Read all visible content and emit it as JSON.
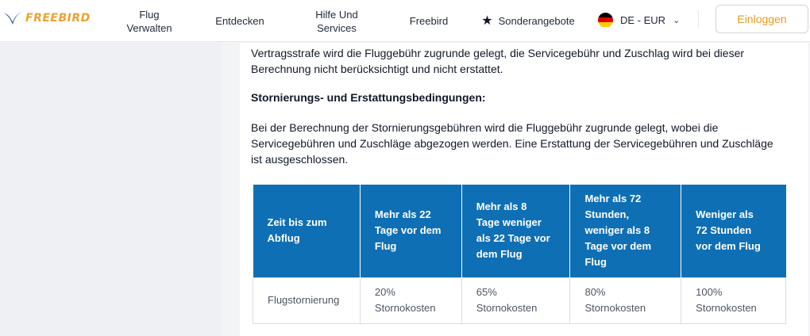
{
  "brand": {
    "name": "FREEBIRD",
    "logo_color": "#f0a030",
    "bird_color": "#1d4f9a"
  },
  "nav": {
    "flug": "Flug\nVerwalten",
    "entdecken": "Entdecken",
    "hilfe": "Hilfe Und\nServices",
    "freebird": "Freebird",
    "sonderangebote": "Sonderangebote",
    "sonderangebote_icon": "star-icon"
  },
  "locale": {
    "label": "DE - EUR",
    "flag_icon": "germany-flag-icon",
    "chevron_icon": "chevron-down-icon"
  },
  "login": {
    "label": "Einloggen"
  },
  "content": {
    "para1": "Vertragsstrafe wird die Fluggebühr zugrunde gelegt, die Servicegebühr und Zuschlag wird bei dieser Berechnung nicht berücksichtigt und nicht erstattet.",
    "heading": "Stornierungs- und Erstattungsbedingungen:",
    "para2": "Bei der Berechnung der Stornierungsgebühren wird die Fluggebühr zugrunde gelegt, wobei die Servicegebühren und Zuschläge abgezogen werden. Eine Erstattung der Servicegebühren und Zuschläge ist ausgeschlossen."
  },
  "table": {
    "headers": [
      "Zeit bis zum\nAbflug",
      "Mehr als 22\nTage vor dem\nFlug",
      "Mehr als 8\nTage weniger\nals 22 Tage vor\ndem Flug",
      "Mehr als 72\nStunden,\nweniger als 8\nTage vor dem\nFlug",
      "Weniger als\n72 Stunden\nvor dem Flug"
    ],
    "rows": [
      [
        "Flugstornierung",
        "20%\nStornokosten",
        "65%\nStornokosten",
        "80%\nStornokosten",
        "100%\nStornokosten"
      ]
    ]
  },
  "colors": {
    "header_blue": "#0f6fb5",
    "login_text": "#ea9a1c"
  }
}
